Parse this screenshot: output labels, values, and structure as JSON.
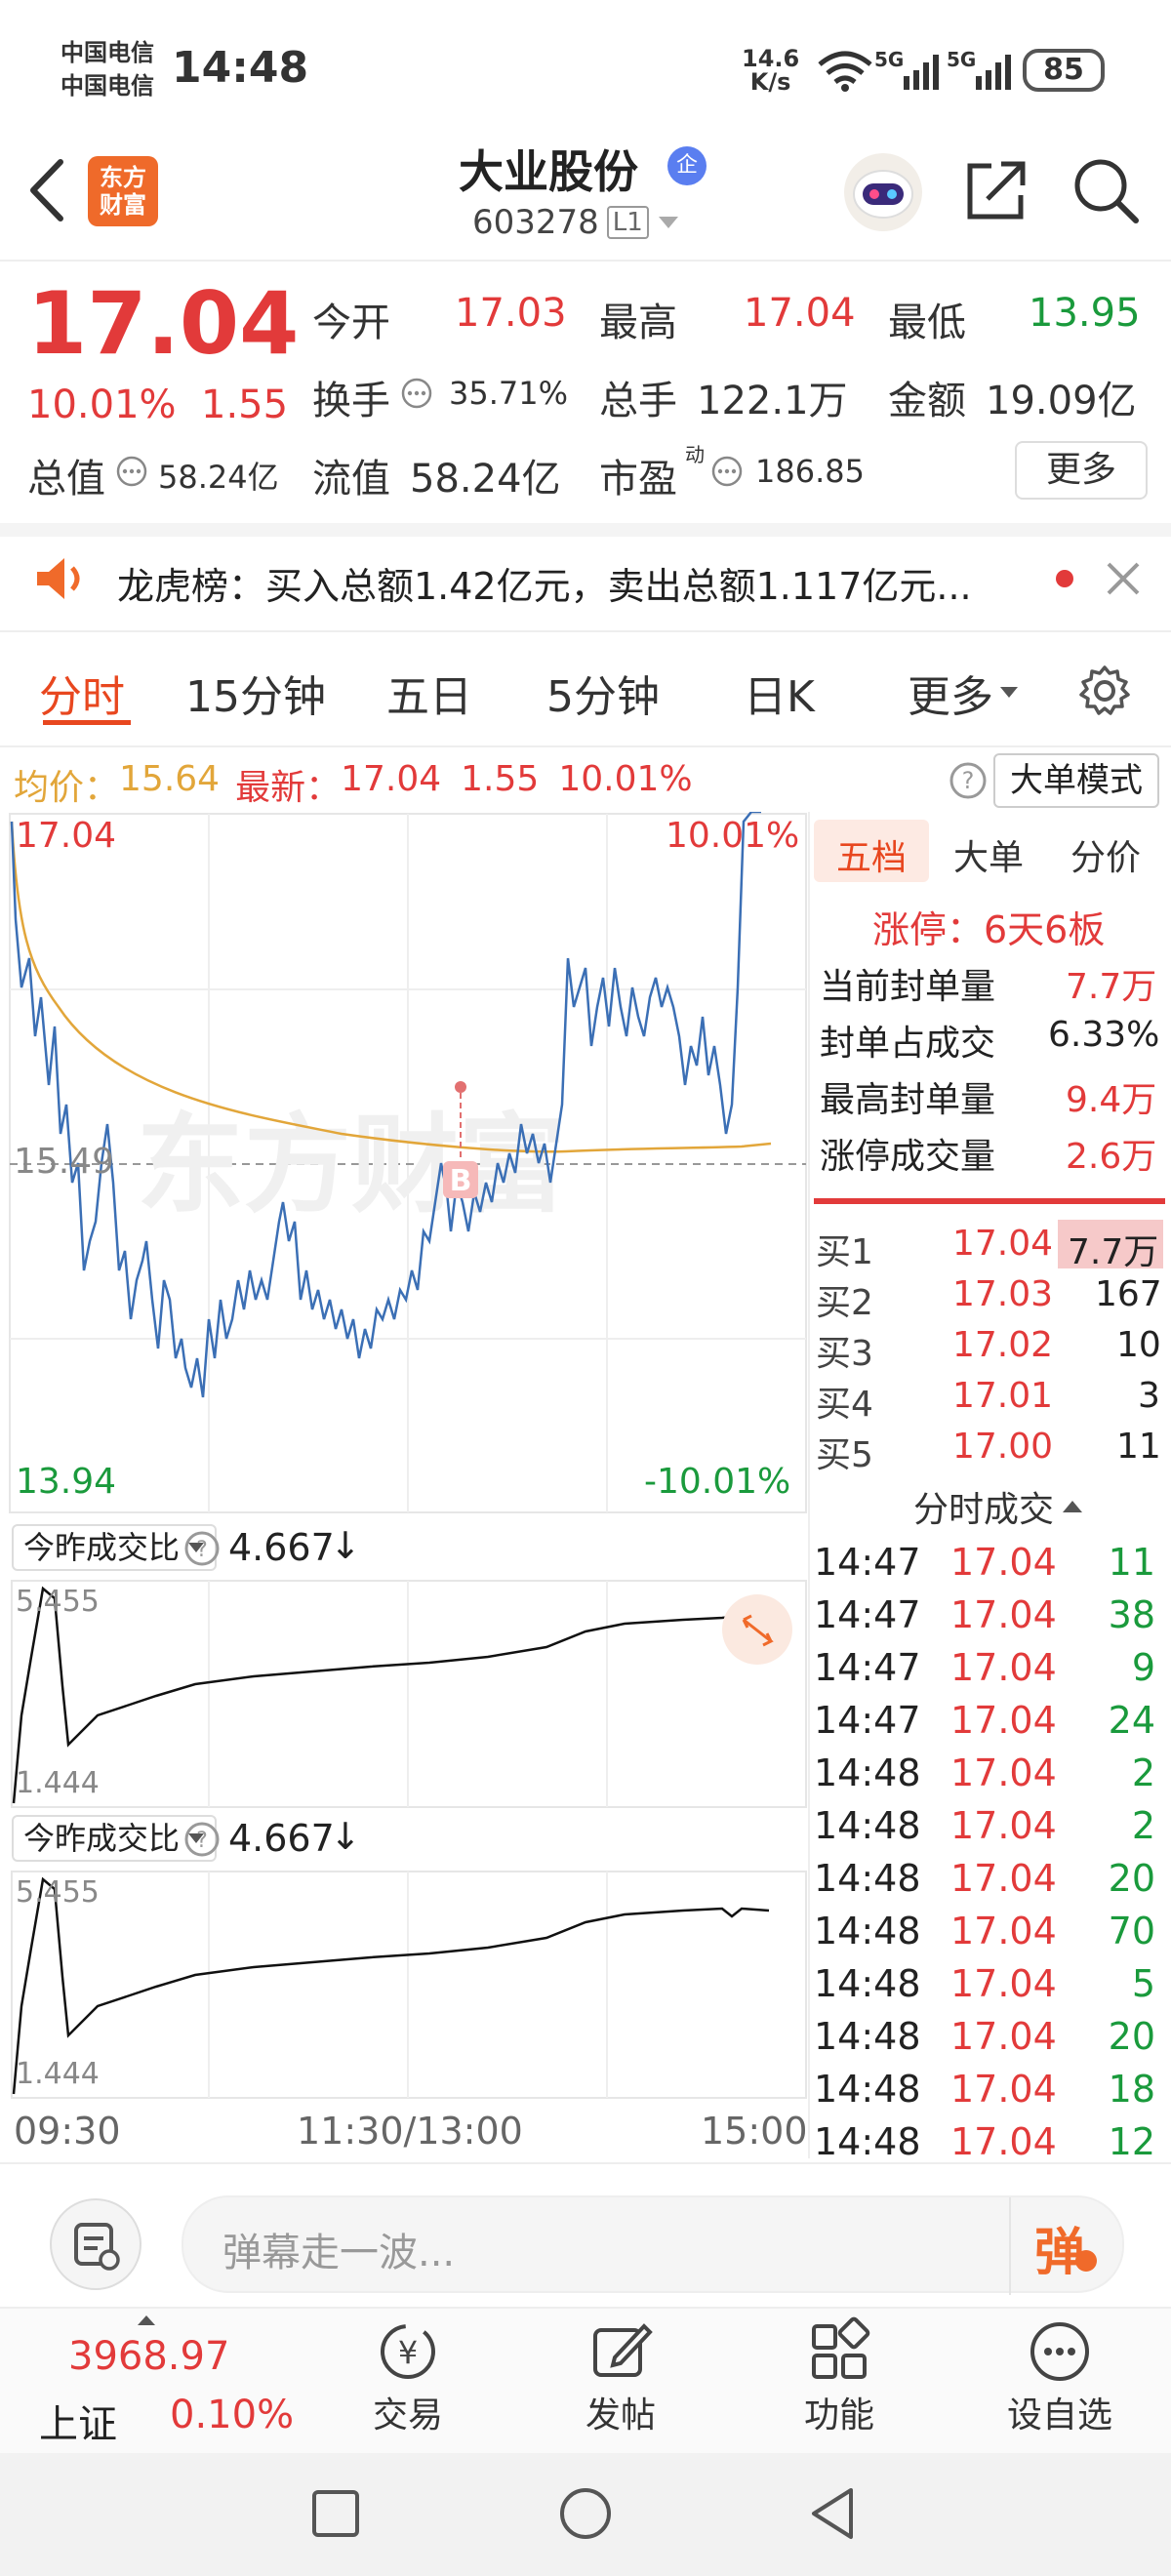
{
  "status_bar": {
    "carrier1": "中国电信",
    "carrier2": "中国电信",
    "time": "14:48",
    "net_speed_value": "14.6",
    "net_speed_unit": "K/s",
    "battery": "85"
  },
  "header": {
    "logo_line1": "东方",
    "logo_line2": "财富",
    "stock_name": "大业股份",
    "badge": "企",
    "code": "603278",
    "level": "L1"
  },
  "quote": {
    "price": "17.04",
    "change_pct": "10.01%",
    "change_amt": "1.55",
    "open_label": "今开",
    "open": "17.03",
    "high_label": "最高",
    "high": "17.04",
    "low_label": "最低",
    "low": "13.95",
    "turnover_label": "换手",
    "turnover": "35.71%",
    "volume_label": "总手",
    "volume": "122.1万",
    "amount_label": "金额",
    "amount": "19.09亿",
    "mktcap_label": "总值",
    "mktcap": "58.24亿",
    "float_label": "流值",
    "float": "58.24亿",
    "pe_label": "市盈",
    "pe_sup": "动",
    "pe": "186.85",
    "more": "更多"
  },
  "news": {
    "text": "龙虎榜：买入总额1.42亿元，卖出总额1.117亿元..."
  },
  "tabs": {
    "items": [
      "分时",
      "15分钟",
      "五日",
      "5分钟",
      "日K"
    ],
    "more": "更多"
  },
  "info_line": {
    "avg_label": "均价：",
    "avg": "15.64",
    "latest_label": "最新：",
    "latest": "17.04",
    "chg": "1.55",
    "pct": "10.01%",
    "mode_button": "大单模式"
  },
  "chart": {
    "top_price": "17.04",
    "top_pct": "10.01%",
    "mid_price": "15.49",
    "bottom_price": "13.94",
    "bottom_pct": "-10.01%",
    "marker": "B",
    "watermark": "东方财富",
    "x_labels": [
      "09:30",
      "11:30/13:00",
      "15:00"
    ]
  },
  "sub1": {
    "selector": "今昨成交比",
    "value": "4.667",
    "arrow": "↓",
    "top": "5.455",
    "bottom": "1.444"
  },
  "sub2": {
    "selector": "今昨成交比",
    "value": "4.667",
    "arrow": "↓",
    "top": "5.455",
    "bottom": "1.444"
  },
  "side": {
    "tabs": [
      "五档",
      "大单",
      "分价"
    ],
    "limit_up": "涨停：6天6板",
    "stats": [
      {
        "label": "当前封单量",
        "value": "7.7万"
      },
      {
        "label": "封单占成交",
        "value": "6.33%"
      },
      {
        "label": "最高封单量",
        "value": "9.4万"
      },
      {
        "label": "涨停成交量",
        "value": "2.6万"
      }
    ],
    "bids": [
      {
        "label": "买1",
        "price": "17.04",
        "vol": "7.7万"
      },
      {
        "label": "买2",
        "price": "17.03",
        "vol": "167"
      },
      {
        "label": "买3",
        "price": "17.02",
        "vol": "10"
      },
      {
        "label": "买4",
        "price": "17.01",
        "vol": "3"
      },
      {
        "label": "买5",
        "price": "17.00",
        "vol": "11"
      }
    ],
    "trades_header": "分时成交",
    "trades": [
      {
        "time": "14:47",
        "price": "17.04",
        "vol": "11"
      },
      {
        "time": "14:47",
        "price": "17.04",
        "vol": "38"
      },
      {
        "time": "14:47",
        "price": "17.04",
        "vol": "9"
      },
      {
        "time": "14:47",
        "price": "17.04",
        "vol": "24"
      },
      {
        "time": "14:48",
        "price": "17.04",
        "vol": "2"
      },
      {
        "time": "14:48",
        "price": "17.04",
        "vol": "2"
      },
      {
        "time": "14:48",
        "price": "17.04",
        "vol": "20"
      },
      {
        "time": "14:48",
        "price": "17.04",
        "vol": "70"
      },
      {
        "time": "14:48",
        "price": "17.04",
        "vol": "5"
      },
      {
        "time": "14:48",
        "price": "17.04",
        "vol": "20"
      },
      {
        "time": "14:48",
        "price": "17.04",
        "vol": "18"
      },
      {
        "time": "14:48",
        "price": "17.04",
        "vol": "12"
      }
    ]
  },
  "danmu": {
    "placeholder": "弹幕走一波...",
    "button": "弹"
  },
  "bottom_nav": {
    "index_value": "3968.97",
    "index_name": "上证",
    "index_pct": "0.10%",
    "trade": "交易",
    "post": "发帖",
    "func": "功能",
    "watch": "设自选"
  },
  "colors": {
    "up": "#e23a3a",
    "down": "#1a9a3c",
    "accent": "#e8471f",
    "price_line": "#3b6fb5",
    "avg_line": "#e2a63a"
  }
}
